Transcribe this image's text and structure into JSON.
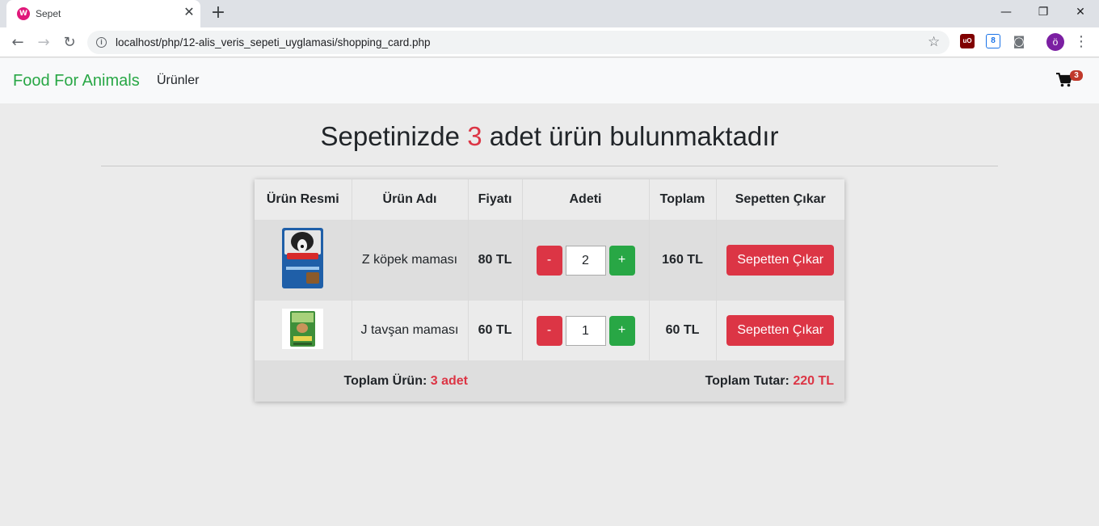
{
  "browser": {
    "tab_title": "Sepet",
    "tab_close": "✕",
    "new_tab": "+",
    "url": "localhost/php/12-alis_veris_sepeti_uyglamasi/shopping_card.php",
    "profile_initial": "ö",
    "window_controls": {
      "minimize": "—",
      "maximize": "❐",
      "close": "✕"
    }
  },
  "navbar": {
    "brand": "Food For Animals",
    "link": "Ürünler",
    "cart_count": "3"
  },
  "heading": {
    "before": "Sepetinizde ",
    "count": "3",
    "after": " adet ürün bulunmaktadır"
  },
  "table": {
    "headers": [
      "Ürün Resmi",
      "Ürün Adı",
      "Fiyatı",
      "Adeti",
      "Toplam",
      "Sepetten Çıkar"
    ],
    "rows": [
      {
        "name": "Z köpek maması",
        "price": "80 TL",
        "quantity": "2",
        "total": "160 TL",
        "minus": "-",
        "plus": "+",
        "remove": "Sepetten Çıkar"
      },
      {
        "name": "J tavşan maması",
        "price": "60 TL",
        "quantity": "1",
        "total": "60 TL",
        "minus": "-",
        "plus": "+",
        "remove": "Sepetten Çıkar"
      }
    ],
    "footer": {
      "items_label": "Toplam Ürün:",
      "items_value": "3 adet",
      "sum_label": "Toplam Tutar:",
      "sum_value": "220 TL"
    }
  },
  "colors": {
    "brand": "#28a745",
    "danger": "#dc3545",
    "success": "#28a745"
  }
}
